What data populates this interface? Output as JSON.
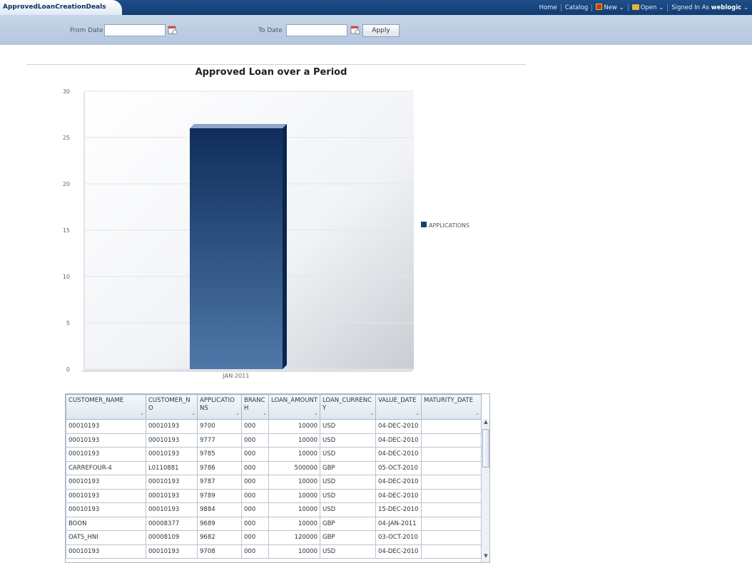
{
  "header": {
    "tab_title": "ApprovedLoanCreationDeals",
    "links": {
      "home": "Home",
      "catalog": "Catalog",
      "new": "New",
      "open": "Open",
      "signed_in_as": "Signed In As",
      "user": "weblogic"
    }
  },
  "prompt": {
    "from_date_label": "From Date",
    "from_date_value": "",
    "to_date_label": "To Date",
    "to_date_value": "",
    "apply_label": "Apply"
  },
  "chart_data": {
    "type": "bar",
    "title": "Approved Loan over a Period",
    "categories": [
      "JAN-2011"
    ],
    "series": [
      {
        "name": "APPLICATIONS",
        "values": [
          26
        ]
      }
    ],
    "ylim": [
      0,
      30
    ],
    "yticks": [
      0,
      5,
      10,
      15,
      20,
      25,
      30
    ],
    "grid": true,
    "legend": "right",
    "bar_color": "#1c3f72"
  },
  "table": {
    "columns": [
      "CUSTOMER_NAME",
      "CUSTOMER_NO",
      "APPLICATIONS",
      "BRANCH",
      "LOAN_AMOUNT",
      "LOAN_CURRENCY",
      "VALUE_DATE",
      "MATURITY_DATE"
    ],
    "rows": [
      [
        "00010193",
        "00010193",
        "9700",
        "000",
        "10000",
        "USD",
        "04-DEC-2010",
        ""
      ],
      [
        "00010193",
        "00010193",
        "9777",
        "000",
        "10000",
        "USD",
        "04-DEC-2010",
        ""
      ],
      [
        "00010193",
        "00010193",
        "9785",
        "000",
        "10000",
        "USD",
        "04-DEC-2010",
        ""
      ],
      [
        "CARREFOUR-4",
        "L0110881",
        "9786",
        "000",
        "500000",
        "GBP",
        "05-OCT-2010",
        ""
      ],
      [
        "00010193",
        "00010193",
        "9787",
        "000",
        "10000",
        "USD",
        "04-DEC-2010",
        ""
      ],
      [
        "00010193",
        "00010193",
        "9789",
        "000",
        "10000",
        "USD",
        "04-DEC-2010",
        ""
      ],
      [
        "00010193",
        "00010193",
        "9884",
        "000",
        "10000",
        "USD",
        "15-DEC-2010",
        ""
      ],
      [
        "BOON",
        "00008377",
        "9689",
        "000",
        "10000",
        "GBP",
        "04-JAN-2011",
        ""
      ],
      [
        "OATS_HNI",
        "00008109",
        "9682",
        "000",
        "120000",
        "GBP",
        "03-OCT-2010",
        ""
      ],
      [
        "00010193",
        "00010193",
        "9708",
        "000",
        "10000",
        "USD",
        "04-DEC-2010",
        ""
      ]
    ]
  },
  "icons": {
    "calendar": "calendar-icon",
    "sort": "sort-icon",
    "chevron": "chevron-down-icon"
  }
}
